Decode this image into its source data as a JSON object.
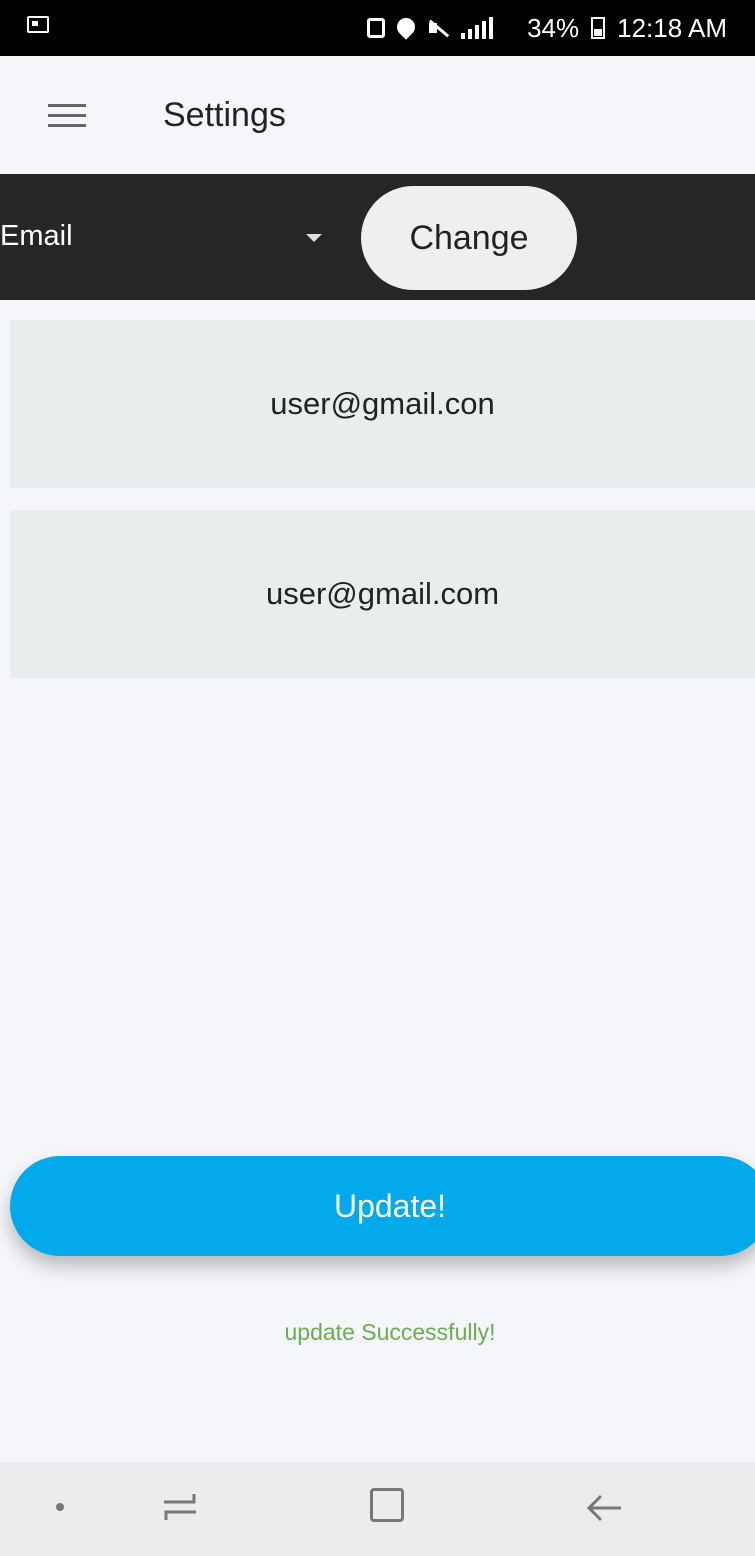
{
  "status_bar": {
    "battery": "34%",
    "time": "12:18 AM",
    "icons": [
      "gallery-icon",
      "lock-icon",
      "location-icon",
      "mute-icon",
      "wifi-signal-icon",
      "battery-icon"
    ]
  },
  "app_bar": {
    "title": "Settings",
    "menu_icon": "hamburger-menu-icon"
  },
  "selector": {
    "selected": "Email",
    "change_label": "Change"
  },
  "fields": {
    "current_email": "user@gmail.con",
    "new_email": "user@gmail.com"
  },
  "actions": {
    "update_label": "Update!",
    "success_message": "update Successfully!"
  },
  "colors": {
    "accent": "#03a9ea",
    "success": "#6aae4f",
    "selector_bar": "#262626"
  },
  "nav_bar": {
    "icons": [
      "dot-icon",
      "recent-apps-icon",
      "home-icon",
      "back-icon"
    ]
  }
}
